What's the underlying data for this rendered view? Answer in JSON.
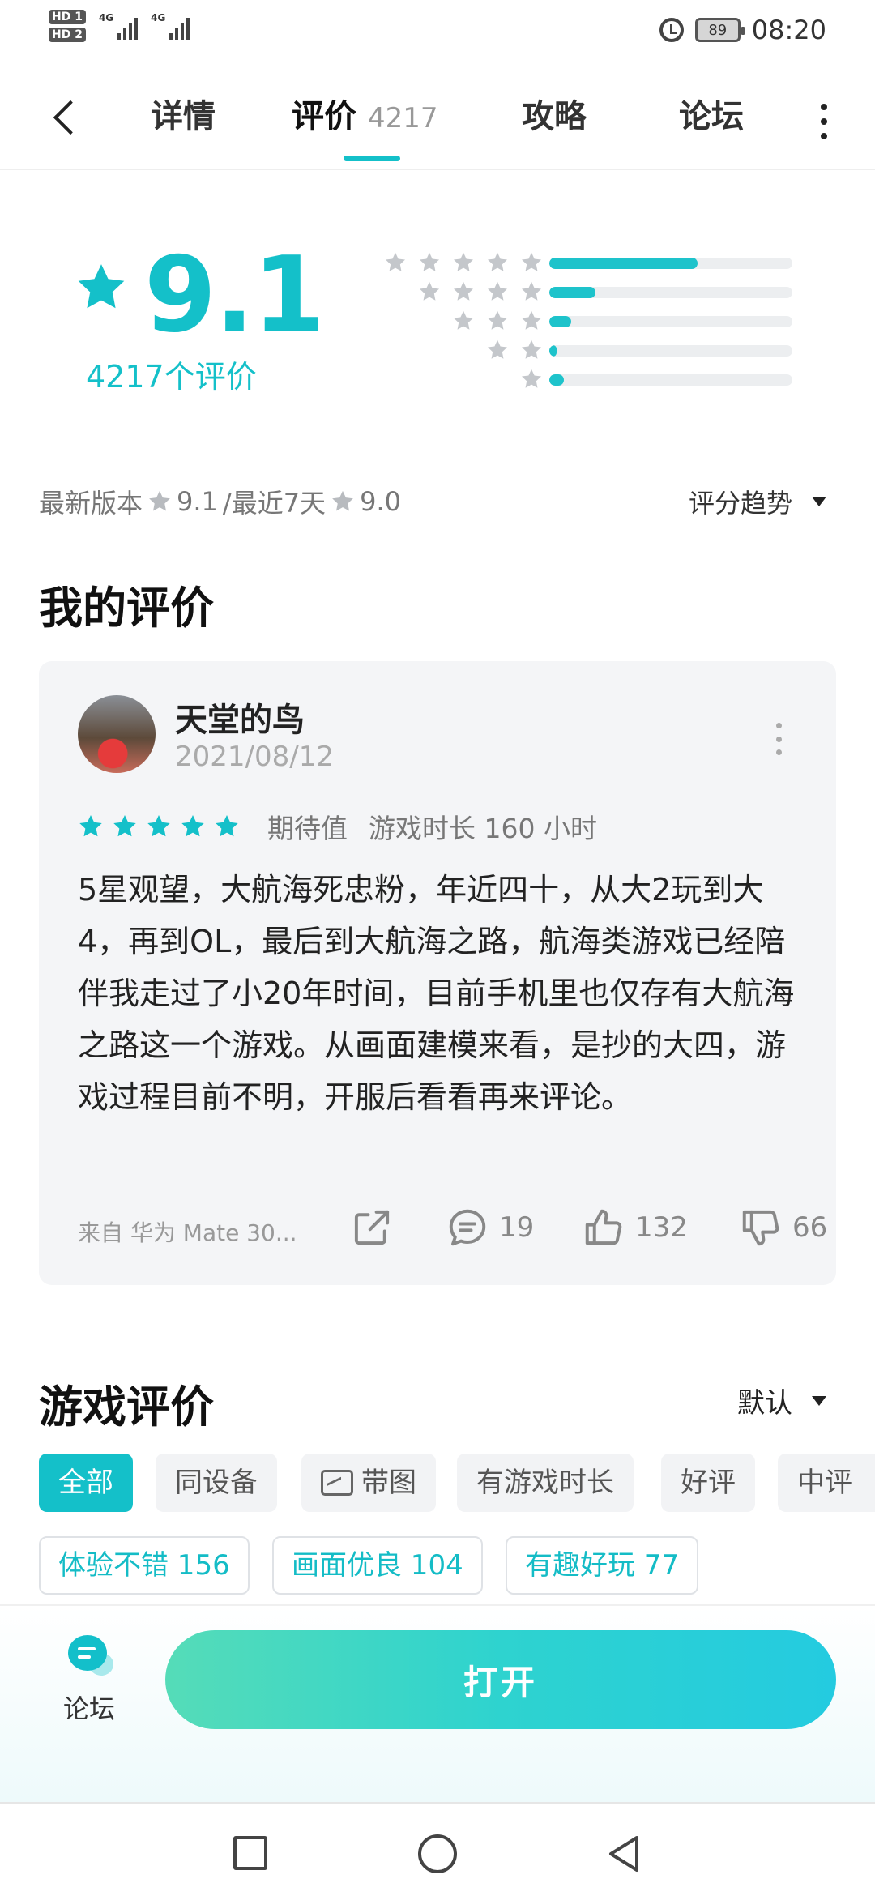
{
  "status_bar": {
    "hd1": "HD 1",
    "hd2": "HD 2",
    "net1": "4G",
    "net2": "4G",
    "battery": "89",
    "time": "08:20"
  },
  "nav": {
    "tabs": [
      {
        "label": "详情"
      },
      {
        "label": "评价",
        "count": "4217",
        "active": true
      },
      {
        "label": "攻略"
      },
      {
        "label": "论坛"
      }
    ]
  },
  "rating": {
    "score": "9.1",
    "count_label": "4217个评价",
    "distribution": [
      {
        "stars": 5,
        "fraction": 0.61
      },
      {
        "stars": 4,
        "fraction": 0.19
      },
      {
        "stars": 3,
        "fraction": 0.09
      },
      {
        "stars": 2,
        "fraction": 0.03
      },
      {
        "stars": 1,
        "fraction": 0.06
      }
    ],
    "latest_version_label": "最新版本",
    "latest_version_score": "9.1",
    "recent_label": "/最近7天",
    "recent_score": "9.0",
    "trend_label": "评分趋势"
  },
  "my_review": {
    "section_title": "我的评价",
    "user_name": "天堂的鸟",
    "date": "2021/08/12",
    "stars": 5,
    "tag": "期待值",
    "playtime": "游戏时长 160 小时",
    "text": "5星观望，大航海死忠粉，年近四十，从大2玩到大4，再到OL，最后到大航海之路，航海类游戏已经陪伴我走过了小20年时间，目前手机里也仅存有大航海之路这一个游戏。从画面建模来看，是抄的大四，游戏过程目前不明，开服后看看再来评论。",
    "device": "来自 华为 Mate 30...",
    "comments": "19",
    "likes": "132",
    "dislikes": "66"
  },
  "game_reviews": {
    "section_title": "游戏评价",
    "sort_label": "默认",
    "filters": [
      "全部",
      "同设备",
      "带图",
      "有游戏时长",
      "好评",
      "中评"
    ],
    "tags": [
      "体验不错 156",
      "画面优良 104",
      "有趣好玩 77"
    ]
  },
  "bottom_bar": {
    "forum_label": "论坛",
    "open_label": "打开"
  },
  "colors": {
    "accent": "#14c0c9",
    "star_gray": "#c4c7cb",
    "text": "#222222"
  }
}
